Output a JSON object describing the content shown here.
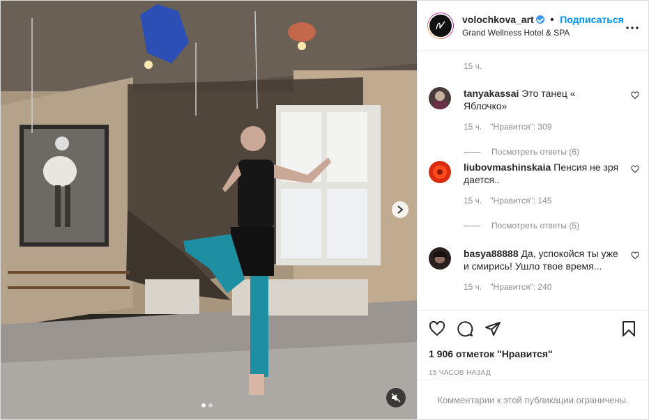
{
  "post": {
    "username": "volochkova_art",
    "separator": "•",
    "follow_label": "Подписаться",
    "location": "Grand Wellness Hotel & SPA",
    "more_icon": "more-horizontal-icon",
    "verified": true
  },
  "caption_time": "15 ч.",
  "comments": [
    {
      "user": "tanyakassai",
      "text": "Это танец « Яблочко»",
      "time": "15 ч.",
      "likes": "\"Нравится\": 309",
      "replies": "Посмотреть ответы (6)",
      "avatar_color": "#4a3a3a"
    },
    {
      "user": "liubovmashinskaia",
      "text": "Пенсия не зря дается..",
      "time": "15 ч.",
      "likes": "\"Нравится\": 145",
      "replies": "Посмотреть ответы (5)",
      "avatar_color": "#d82c10"
    },
    {
      "user": "basya88888",
      "text": "Да, успокойся ты уже и смирись! Ушло твое время...",
      "time": "15 ч.",
      "likes": "\"Нравится\": 240",
      "replies": "",
      "avatar_color": "#2a2020"
    }
  ],
  "actions": {
    "like_icon": "heart-icon",
    "comment_icon": "comment-icon",
    "share_icon": "share-icon",
    "save_icon": "bookmark-icon"
  },
  "likes_text": "1 906 отметок \"Нравится\"",
  "time_ago": "15 часов назад",
  "comments_limited": "Комментарии к этой публикации ограничены.",
  "media": {
    "carousel_count": 2,
    "carousel_active": 0
  },
  "colors": {
    "accent": "#0095f6",
    "muted": "#8e8e8e",
    "text": "#262626"
  }
}
